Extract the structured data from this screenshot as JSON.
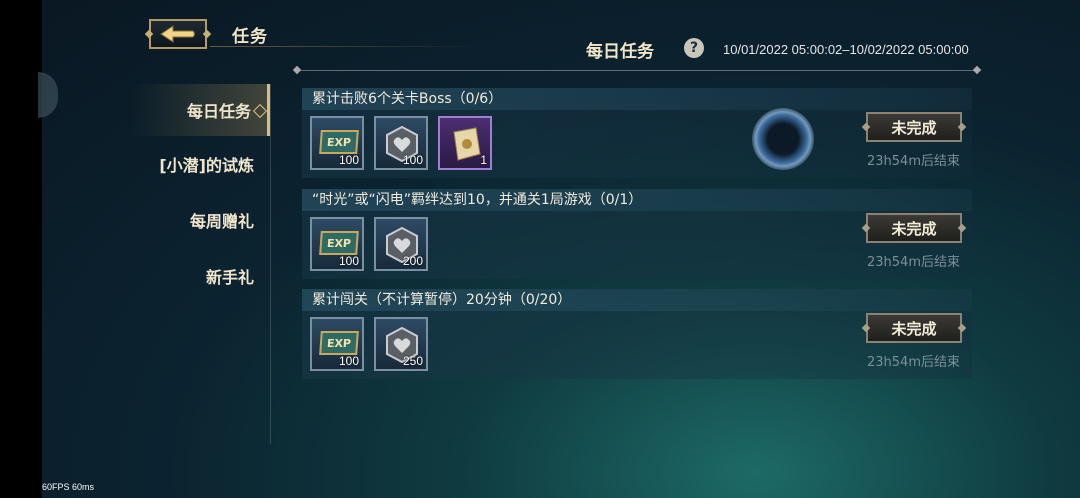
{
  "header": {
    "title": "任务"
  },
  "sidebar": {
    "items": [
      {
        "label": "每日任务",
        "active": true
      },
      {
        "label": "[小潜]的试炼",
        "active": false
      },
      {
        "label": "每周赠礼",
        "active": false
      },
      {
        "label": "新手礼",
        "active": false
      }
    ]
  },
  "section": {
    "title": "每日任务",
    "help_icon": "?",
    "time_range": "10/01/2022 05:00:02–10/02/2022 05:00:00"
  },
  "tasks": [
    {
      "title": "累计击败6个关卡Boss（0/6）",
      "status": "未完成",
      "timer": "23h54m后结束",
      "rewards": [
        {
          "type": "exp",
          "label": "EXP",
          "count": "100"
        },
        {
          "type": "heart",
          "count": "100"
        },
        {
          "type": "scroll",
          "count": "1"
        }
      ]
    },
    {
      "title": "“时光”或“闪电”羁绊达到10，并通关1局游戏（0/1）",
      "status": "未完成",
      "timer": "23h54m后结束",
      "rewards": [
        {
          "type": "exp",
          "label": "EXP",
          "count": "100"
        },
        {
          "type": "heart",
          "count": "200"
        }
      ]
    },
    {
      "title": "累计闯关（不计算暂停）20分钟（0/20）",
      "status": "未完成",
      "timer": "23h54m后结束",
      "rewards": [
        {
          "type": "exp",
          "label": "EXP",
          "count": "100"
        },
        {
          "type": "heart",
          "count": "250"
        }
      ]
    }
  ],
  "overlay": {
    "fps": "60FPS   60ms"
  },
  "colors": {
    "gold": "#d9bf7c",
    "background": "#0f3a40",
    "exp_badge": "#2f6b65"
  }
}
